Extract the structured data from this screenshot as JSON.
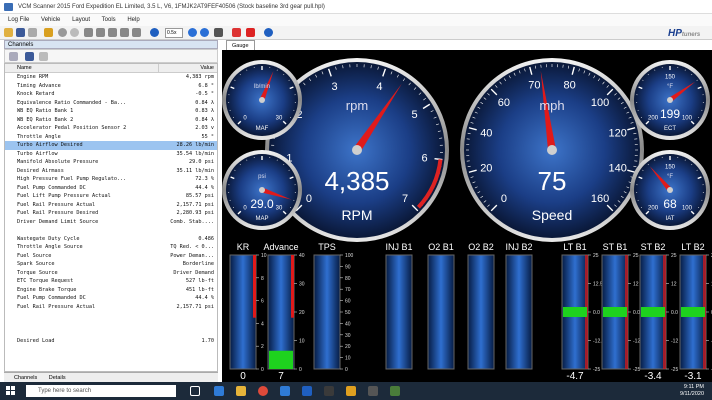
{
  "window": {
    "title": "VCM Scanner 2015 Ford Expedition EL Limited, 3.5 L, V6, 1FMJK2AT9FEF40506 (Stock baseline 3rd gear pull.hpl)"
  },
  "menu": [
    "Log File",
    "Vehicle",
    "Layout",
    "Tools",
    "Help"
  ],
  "toolbar": {
    "zoom": "0.5x"
  },
  "brand": {
    "name": "HP",
    "suffix": "tuners"
  },
  "channels": {
    "title": "Channels",
    "col_name": "Name",
    "col_value": "Value",
    "rows": [
      {
        "name": "Engine RPM",
        "value": "4,383 rpm"
      },
      {
        "name": "Timing Advance",
        "value": "6.8 °"
      },
      {
        "name": "Knock Retard",
        "value": "-0.5 °"
      },
      {
        "name": "Equivalence Ratio Commanded - Ba...",
        "value": "0.84 λ"
      },
      {
        "name": "WB EQ Ratio Bank 1",
        "value": "0.83 λ"
      },
      {
        "name": "WB EQ Ratio Bank 2",
        "value": "0.84 λ"
      },
      {
        "name": "Accelerator Pedal Position Sensor 2",
        "value": "2.03 v"
      },
      {
        "name": "Throttle Angle",
        "value": "55 °"
      },
      {
        "name": "Turbo Airflow Desired",
        "value": "28.26 lb/min",
        "selected": true
      },
      {
        "name": "Turbo Airflow",
        "value": "35.54 lb/min"
      },
      {
        "name": "Manifold Absolute Pressure",
        "value": "29.0 psi"
      },
      {
        "name": "Desired Airmass",
        "value": "35.11 lb/min"
      },
      {
        "name": "High Pressure Fuel Pump Regulato...",
        "value": "72.3 %"
      },
      {
        "name": "Fuel Pump Commanded DC",
        "value": "44.4 %"
      },
      {
        "name": "Fuel Lift Pump Pressure Actual",
        "value": "85.57 psi"
      },
      {
        "name": "Fuel Rail Pressure Actual",
        "value": "2,157.71 psi"
      },
      {
        "name": "Fuel Rail Pressure Desired",
        "value": "2,280.93 psi"
      },
      {
        "name": "Driver Demand Limit Source",
        "value": "Comb. Stab...."
      },
      {
        "name": "",
        "value": "",
        "gap": true
      },
      {
        "name": "Wastegate Duty Cycle",
        "value": "0.486"
      },
      {
        "name": "Throttle Angle Source",
        "value": "TQ Red. < 0..."
      },
      {
        "name": "Fuel Source",
        "value": "Power Deman..."
      },
      {
        "name": "Spark Source",
        "value": "Borderline"
      },
      {
        "name": "Torque Source",
        "value": "Driver Demand"
      },
      {
        "name": "ETC Torque Request",
        "value": "527 lb-ft"
      },
      {
        "name": "Engine Brake Torque",
        "value": "451 lb-ft"
      },
      {
        "name": "Fuel Pump Commanded DC",
        "value": "44.4 %"
      },
      {
        "name": "Fuel Rail Pressure Actual",
        "value": "2,157.71 psi"
      },
      {
        "name": "",
        "value": "",
        "gap": true
      },
      {
        "name": "",
        "value": "",
        "gap": true
      },
      {
        "name": "",
        "value": "",
        "gap": true
      },
      {
        "name": "Desired Load",
        "value": "1.70"
      }
    ],
    "tabs": [
      "Channels",
      "Details"
    ]
  },
  "gauge_tab": "Gauge",
  "gauges": [
    {
      "id": "rpm",
      "unit": "rpm",
      "value": "4,385",
      "label": "RPM",
      "ticks": [
        "0",
        "1",
        "2",
        "3",
        "4",
        "5",
        "6",
        "7"
      ],
      "frac": 0.626
    },
    {
      "id": "speed",
      "unit": "mph",
      "value": "75",
      "label": "Speed",
      "ticks": [
        "0",
        "20",
        "40",
        "60",
        "70",
        "80",
        "100",
        "120",
        "140",
        "160"
      ],
      "frac": 0.47
    },
    {
      "id": "maf",
      "unit": "lb/min",
      "label": "MAF",
      "ticks": [
        "0",
        "30"
      ],
      "frac": 0.58
    },
    {
      "id": "map",
      "unit": "psi",
      "value": "29.0",
      "label": "MAP",
      "ticks": [
        "0",
        "30"
      ],
      "frac": 0.9
    },
    {
      "id": "ect",
      "unit": "°F",
      "value": "199",
      "label": "ECT",
      "ticks": [
        "200",
        "150",
        "100"
      ],
      "frac": 0.7
    },
    {
      "id": "iat",
      "unit": "°F",
      "value": "68",
      "label": "IAT",
      "ticks": [
        "200",
        "150",
        "100"
      ],
      "frac": 0.35
    }
  ],
  "bars": [
    {
      "label": "KR",
      "value": "0",
      "scale": [
        "10",
        "8",
        "6",
        "4",
        "2",
        "0"
      ],
      "level": 0.0
    },
    {
      "label": "Advance",
      "value": "7",
      "scale": [
        "40",
        "30",
        "20",
        "10",
        "0"
      ],
      "level": 0.16
    },
    {
      "label": "TPS",
      "value": "",
      "scale": [
        "100",
        "90",
        "80",
        "70",
        "60",
        "50",
        "40",
        "30",
        "20",
        "10",
        "0"
      ],
      "level": 0.0
    },
    {
      "label": "INJ B1",
      "value": "",
      "scale": [],
      "level": 0.0
    },
    {
      "label": "O2 B1",
      "value": "",
      "scale": [],
      "level": 0.0
    },
    {
      "label": "O2 B2",
      "value": "",
      "scale": [],
      "level": 0.0
    },
    {
      "label": "INJ B2",
      "value": "",
      "scale": [],
      "level": 0.0
    },
    {
      "label": "LT B1",
      "value": "-4.7",
      "scale": [
        "25",
        "12.5",
        "0.0",
        "-12.5",
        "-25"
      ],
      "level": 0.5
    },
    {
      "label": "ST B1",
      "value": "",
      "scale": [
        "25",
        "12",
        "0.0",
        "-12",
        "-25"
      ],
      "level": 0.5
    },
    {
      "label": "ST B2",
      "value": "-3.4",
      "scale": [
        "25",
        "12",
        "0.0",
        "-12",
        "-25"
      ],
      "level": 0.5
    },
    {
      "label": "LT B2",
      "value": "-3.1",
      "scale": [
        "25",
        "12",
        "0.0",
        "-12",
        "-25"
      ],
      "level": 0.5
    }
  ],
  "taskbar": {
    "search": "Type here to search",
    "time": "9:11 PM",
    "date": "9/11/2020"
  }
}
